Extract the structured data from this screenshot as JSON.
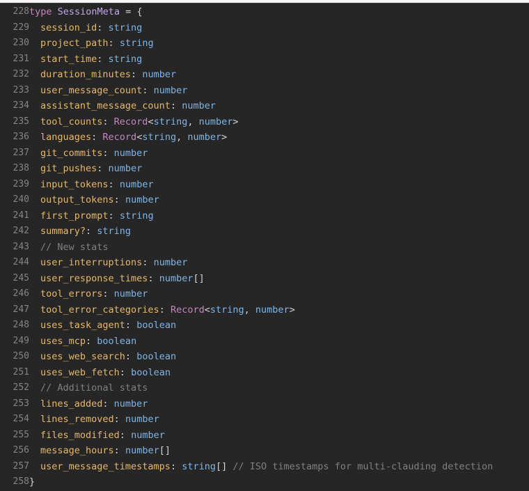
{
  "editor": {
    "header": {
      "line_number": "228",
      "keyword": "type",
      "name": "SessionMeta",
      "assign": " = {"
    },
    "lines": [
      {
        "n": "229",
        "kind": "field",
        "name": "session_id",
        "type": "string"
      },
      {
        "n": "230",
        "kind": "field",
        "name": "project_path",
        "type": "string"
      },
      {
        "n": "231",
        "kind": "field",
        "name": "start_time",
        "type": "string"
      },
      {
        "n": "232",
        "kind": "field",
        "name": "duration_minutes",
        "type": "number"
      },
      {
        "n": "233",
        "kind": "field",
        "name": "user_message_count",
        "type": "number"
      },
      {
        "n": "234",
        "kind": "field",
        "name": "assistant_message_count",
        "type": "number"
      },
      {
        "n": "235",
        "kind": "record",
        "name": "tool_counts",
        "generic": "Record",
        "args": [
          "string",
          "number"
        ]
      },
      {
        "n": "236",
        "kind": "record",
        "name": "languages",
        "generic": "Record",
        "args": [
          "string",
          "number"
        ]
      },
      {
        "n": "237",
        "kind": "field",
        "name": "git_commits",
        "type": "number"
      },
      {
        "n": "238",
        "kind": "field",
        "name": "git_pushes",
        "type": "number"
      },
      {
        "n": "239",
        "kind": "field",
        "name": "input_tokens",
        "type": "number"
      },
      {
        "n": "240",
        "kind": "field",
        "name": "output_tokens",
        "type": "number"
      },
      {
        "n": "241",
        "kind": "field",
        "name": "first_prompt",
        "type": "string"
      },
      {
        "n": "242",
        "kind": "field",
        "name": "summary?",
        "type": "string"
      },
      {
        "n": "243",
        "kind": "comment",
        "text": "// New stats"
      },
      {
        "n": "244",
        "kind": "field",
        "name": "user_interruptions",
        "type": "number"
      },
      {
        "n": "245",
        "kind": "array",
        "name": "user_response_times",
        "type": "number",
        "suffix": "[]"
      },
      {
        "n": "246",
        "kind": "field",
        "name": "tool_errors",
        "type": "number"
      },
      {
        "n": "247",
        "kind": "record",
        "name": "tool_error_categories",
        "generic": "Record",
        "args": [
          "string",
          "number"
        ]
      },
      {
        "n": "248",
        "kind": "field",
        "name": "uses_task_agent",
        "type": "boolean"
      },
      {
        "n": "249",
        "kind": "field",
        "name": "uses_mcp",
        "type": "boolean"
      },
      {
        "n": "250",
        "kind": "field",
        "name": "uses_web_search",
        "type": "boolean"
      },
      {
        "n": "251",
        "kind": "field",
        "name": "uses_web_fetch",
        "type": "boolean"
      },
      {
        "n": "252",
        "kind": "comment",
        "text": "// Additional stats"
      },
      {
        "n": "253",
        "kind": "field",
        "name": "lines_added",
        "type": "number"
      },
      {
        "n": "254",
        "kind": "field",
        "name": "lines_removed",
        "type": "number"
      },
      {
        "n": "255",
        "kind": "field",
        "name": "files_modified",
        "type": "number"
      },
      {
        "n": "256",
        "kind": "array",
        "name": "message_hours",
        "type": "number",
        "suffix": "[]"
      },
      {
        "n": "257",
        "kind": "array_comment",
        "name": "user_message_timestamps",
        "type": "string",
        "suffix": "[]",
        "comment": "// ISO timestamps for multi-clauding detection"
      }
    ],
    "footer": {
      "line_number": "258",
      "text": "}"
    }
  }
}
